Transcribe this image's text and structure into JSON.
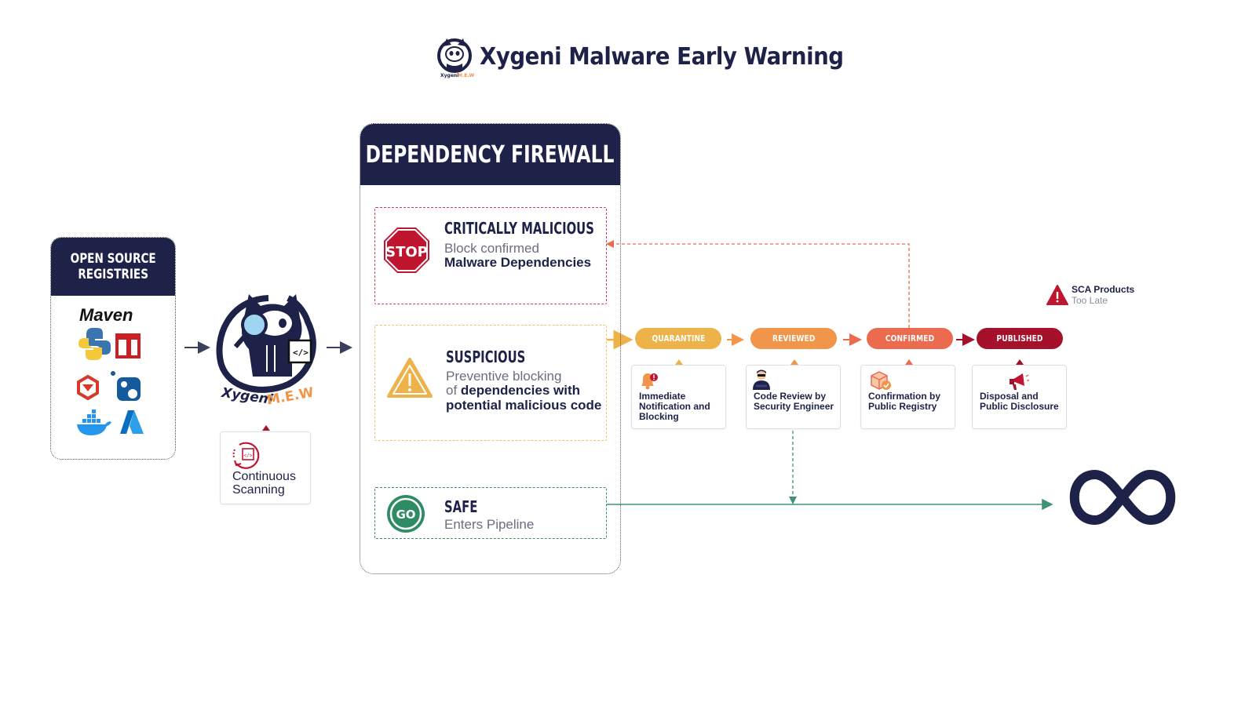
{
  "header": {
    "title": "Xygeni Malware Early Warning",
    "logo_icon": "xygeni-mew-mascot-logo"
  },
  "registries": {
    "title_line1": "OPEN SOURCE",
    "title_line2": "REGISTRIES",
    "logos": [
      "Maven",
      "python-icon",
      "npm-icon",
      "rubygems-icon",
      "nuget-icon",
      "docker-icon",
      "azure-icon"
    ],
    "maven_label": "Maven"
  },
  "mascot": {
    "brand": "Xygeni",
    "suffix": "M.E.W"
  },
  "scanning": {
    "line1": "Continuous",
    "line2": "Scanning"
  },
  "firewall": {
    "title": "DEPENDENCY FIREWALL",
    "zones": [
      {
        "id": "critical",
        "badge": "STOP",
        "title": "CRITICALLY MALICIOUS",
        "light": "Block confirmed",
        "bold": "Malware Dependencies"
      },
      {
        "id": "suspicious",
        "badge": "!",
        "title": "SUSPICIOUS",
        "light": "Preventive blocking",
        "light2": "of ",
        "bold": "dependencies with",
        "bold2": "potential malicious code"
      },
      {
        "id": "safe",
        "badge": "GO",
        "title": "SAFE",
        "light": "Enters Pipeline"
      }
    ]
  },
  "stages": [
    {
      "label": "QUARANTINE",
      "color": "#edb34a",
      "card_line1": "Immediate",
      "card_line2": "Notification and",
      "card_line3": "Blocking",
      "icon": "bell-alert-icon"
    },
    {
      "label": "REVIEWED",
      "color": "#f0954a",
      "card_line1": "Code Review by",
      "card_line2": "Security Engineer",
      "card_line3": "",
      "icon": "security-engineer-icon"
    },
    {
      "label": "CONFIRMED",
      "color": "#ec6b4e",
      "card_line1": "Confirmation by",
      "card_line2": "Public Registry",
      "card_line3": "",
      "icon": "package-check-icon"
    },
    {
      "label": "PUBLISHED",
      "color": "#a5112b",
      "card_line1": "Disposal and",
      "card_line2": "Public Disclosure",
      "card_line3": "",
      "icon": "megaphone-icon"
    }
  ],
  "sca": {
    "title": "SCA Products",
    "subtitle": "Too Late"
  },
  "pipeline": {
    "icon": "infinity-icon"
  },
  "colors": {
    "navy": "#1e2148",
    "critical_red": "#c0152f",
    "warning_amber": "#edb34a",
    "safe_green": "#2e8b63",
    "feedback_orange": "#ec6b4e"
  }
}
